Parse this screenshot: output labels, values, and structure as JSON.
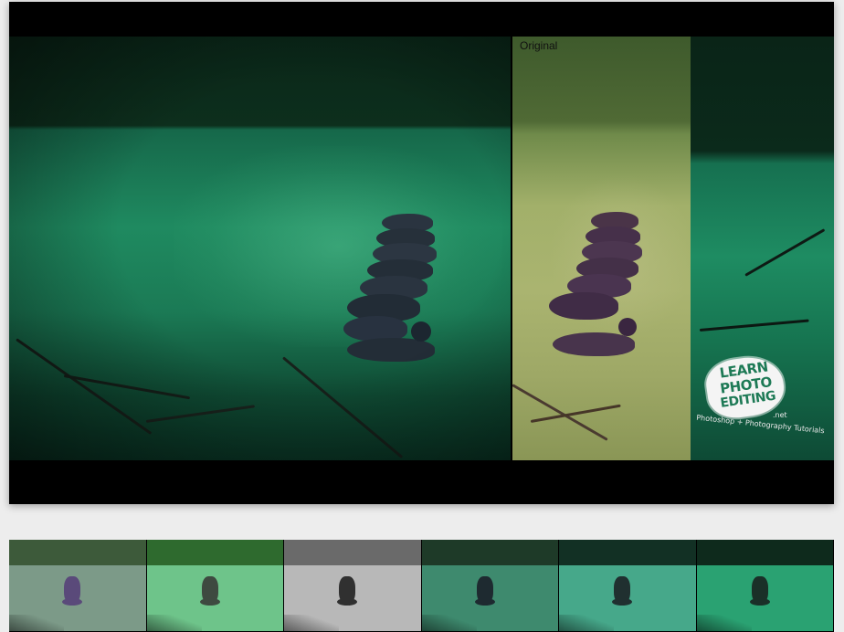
{
  "viewer": {
    "original_label": "Original",
    "logo": {
      "line1": "LEARN",
      "line2": "PHOTO",
      "line3": "EDITING",
      "suffix": ".net",
      "tagline": "Photoshop + Photography Tutorials"
    }
  },
  "filmstrip": {
    "thumbnails": [
      {
        "name": "thumbnail-1",
        "water": "#7c9a88",
        "top": "#3d5a3a",
        "duck": "#5a4a7a"
      },
      {
        "name": "thumbnail-2",
        "water": "#6ec48a",
        "top": "#2e6a2e",
        "duck": "#3e4a40"
      },
      {
        "name": "thumbnail-3",
        "water": "#b8b8b8",
        "top": "#6a6a6a",
        "duck": "#303030"
      },
      {
        "name": "thumbnail-4",
        "water": "#3e8a6e",
        "top": "#1e3a28",
        "duck": "#1e2a30"
      },
      {
        "name": "thumbnail-5",
        "water": "#46a88a",
        "top": "#123024",
        "duck": "#203030"
      },
      {
        "name": "thumbnail-6",
        "water": "#2aa272",
        "top": "#0e2a1c",
        "duck": "#1a3028"
      }
    ]
  }
}
